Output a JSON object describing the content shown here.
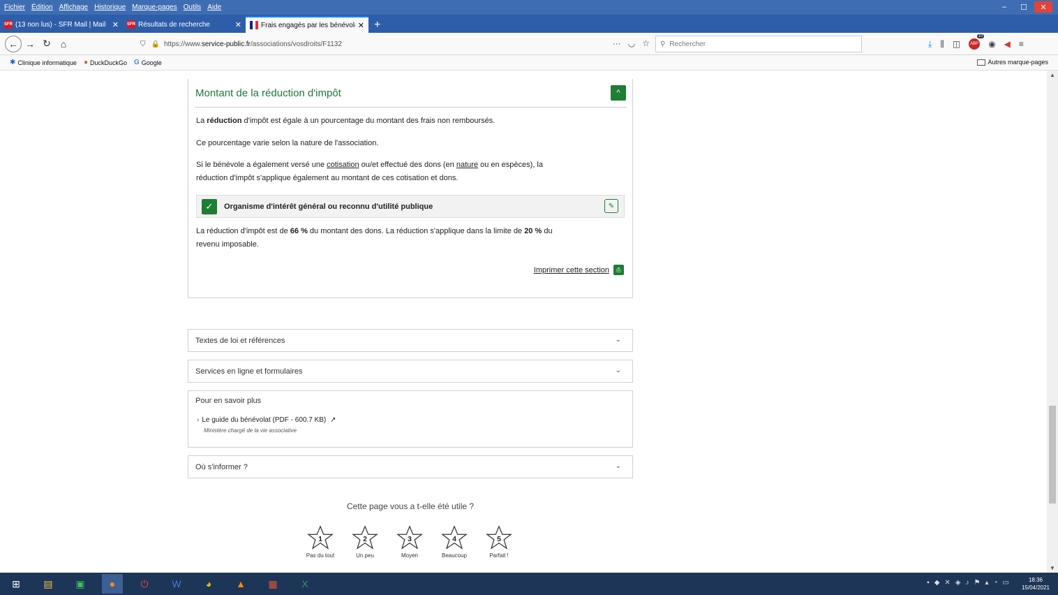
{
  "menubar": {
    "items": [
      "Fichier",
      "Édition",
      "Affichage",
      "Historique",
      "Marque-pages",
      "Outils",
      "Aide"
    ],
    "win_minimize": "–",
    "win_maximize": "☐",
    "win_close": "✕"
  },
  "tabs": [
    {
      "label": "(13 non lus) - SFR Mail | Mail",
      "favicon": "SFR",
      "close": "✕"
    },
    {
      "label": "Résultats de recherche",
      "favicon": "SFR",
      "close": "✕"
    },
    {
      "label": "Frais engagés par les bénévoles",
      "close": "✕"
    }
  ],
  "newtab": "+",
  "nav": {
    "back": "←",
    "forward": "→",
    "reload": "↻",
    "home": "⌂",
    "url_prefix": "https://www.",
    "url_domain": "service-public.fr",
    "url_path": "/associations/vosdroits/F1132",
    "page_actions": "···",
    "search_placeholder": "Rechercher"
  },
  "bookmarks": {
    "items": [
      {
        "label": "Clinique informatique",
        "icon": "✱"
      },
      {
        "label": "DuckDuckGo",
        "icon": "●"
      },
      {
        "label": "Google",
        "icon": "G"
      }
    ],
    "other": "Autres marque-pages"
  },
  "section": {
    "title": "Montant de la réduction d'impôt",
    "toggle": "^",
    "para1_a": "La ",
    "para1_b": "réduction",
    "para1_c": " d'impôt est égale à un pourcentage du montant des frais non remboursés.",
    "para2": "Ce pourcentage varie selon la nature de l'association.",
    "para3_a": "Si le bénévole a également versé une ",
    "para3_link1": "cotisation",
    "para3_b": " ou/et effectué des dons (en ",
    "para3_link2": "nature",
    "para3_c": " ou en espèces), la",
    "para3_line2": "réduction d'impôt s'applique également au montant de ces cotisation et dons.",
    "org_box": "Organisme d'intérêt général ou reconnu d'utilité publique",
    "org_check": "✓",
    "edit_icon": "✎",
    "para4_a": "La réduction d'impôt est de ",
    "para4_b": "66 %",
    "para4_c": " du montant des dons. La réduction s'applique dans la limite de ",
    "para4_d": "20 %",
    "para4_e": " du",
    "para4_line2": "revenu imposable.",
    "print_label": "Imprimer cette section",
    "print_icon": "⎙"
  },
  "accordions": [
    {
      "label": "Textes de loi et références",
      "chevron": "⌄"
    },
    {
      "label": "Services en ligne et formulaires",
      "chevron": "⌄"
    },
    {
      "label": "Où s'informer ?",
      "chevron": "⌄"
    }
  ],
  "learn_more": {
    "title": "Pour en savoir plus",
    "link": "Le guide du bénévolat (PDF - 600.7 KB)",
    "source": "Ministère chargé de la vie associative"
  },
  "feedback": {
    "question": "Cette page vous a t-elle été utile ?",
    "ratings": [
      {
        "num": "1",
        "label": "Pas du tout"
      },
      {
        "num": "2",
        "label": "Un peu"
      },
      {
        "num": "3",
        "label": "Moyen"
      },
      {
        "num": "4",
        "label": "Beaucoup"
      },
      {
        "num": "5",
        "label": "Parfait !"
      }
    ]
  },
  "toolbar_right": {
    "abp_badge": "10"
  },
  "taskbar": {
    "time": "18:36",
    "date": "15/04/2021"
  },
  "colors": {
    "accent_green": "#1e7e34",
    "title_green": "#20773b",
    "firefox_blue": "#2e5ea9"
  }
}
